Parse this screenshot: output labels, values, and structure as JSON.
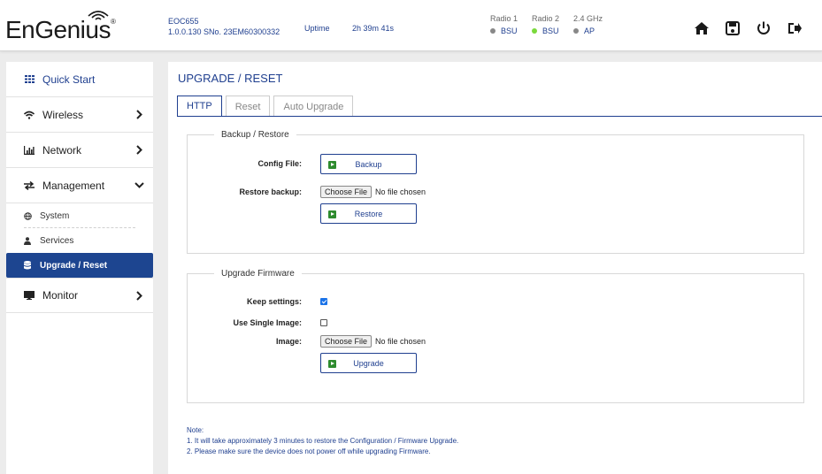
{
  "header": {
    "brand": "EnGenius",
    "brand_mark": "®",
    "model": "EOC655",
    "firmware": "1.0.0.130 SNo. 23EM60300332",
    "uptime_label": "Uptime",
    "uptime_value": "2h 39m 41s",
    "radios": [
      {
        "label": "Radio 1",
        "value": "BSU",
        "color": "#888888"
      },
      {
        "label": "Radio 2",
        "value": "BSU",
        "color": "#7ad93c"
      },
      {
        "label": "2.4 GHz",
        "value": "AP",
        "color": "#888888"
      }
    ]
  },
  "sidebar": {
    "items": [
      {
        "label": "Quick Start",
        "icon": "grid-icon"
      },
      {
        "label": "Wireless",
        "icon": "wifi-icon"
      },
      {
        "label": "Network",
        "icon": "bar-chart-icon"
      },
      {
        "label": "Management",
        "icon": "swap-icon"
      },
      {
        "label": "Monitor",
        "icon": "monitor-icon"
      }
    ],
    "sub_items": [
      {
        "label": "System",
        "icon": "globe-icon"
      },
      {
        "label": "Services",
        "icon": "user-icon"
      },
      {
        "label": "Upgrade / Reset",
        "icon": "database-icon"
      }
    ]
  },
  "main": {
    "title": "UPGRADE / RESET",
    "tabs": [
      "HTTP",
      "Reset",
      "Auto Upgrade"
    ],
    "backup": {
      "legend": "Backup / Restore",
      "config_label": "Config File:",
      "backup_button": "Backup",
      "restore_label": "Restore backup:",
      "choose_file": "Choose File",
      "no_file": "No file chosen",
      "restore_button": "Restore"
    },
    "firmware": {
      "legend": "Upgrade Firmware",
      "keep_label": "Keep settings:",
      "keep_checked": true,
      "single_label": "Use Single Image:",
      "single_checked": false,
      "image_label": "Image:",
      "choose_file": "Choose File",
      "no_file": "No file chosen",
      "upgrade_button": "Upgrade"
    },
    "note": {
      "title": "Note:",
      "line1": "1. It will take approximately 3 minutes to restore the Configuration / Firmware Upgrade.",
      "line2": "2. Please make sure the device does not power off while upgrading Firmware."
    }
  }
}
